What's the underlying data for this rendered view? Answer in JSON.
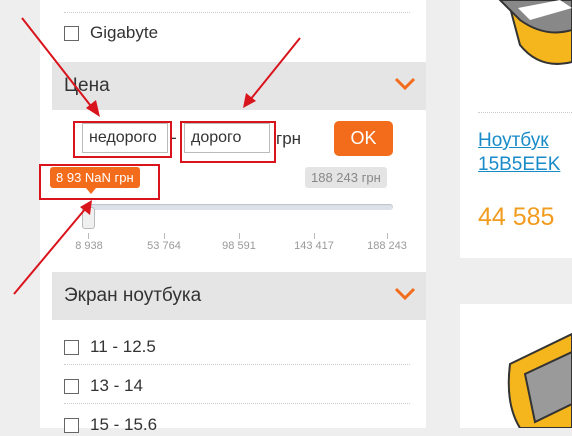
{
  "filters": {
    "brand_item": {
      "label": "Gigabyte"
    },
    "price": {
      "title": "Цена",
      "min_input_value": "недорого",
      "max_input_value": "дорого",
      "dash": "-",
      "currency": "грн",
      "ok_label": "OK",
      "badge_min": "8 93 NaN грн",
      "badge_max": "188 243 грн",
      "slider_level": 0.0,
      "ticks": [
        "8 938",
        "53 764",
        "98 591",
        "143 417",
        "188 243"
      ]
    },
    "screen": {
      "title": "Экран ноутбука",
      "items": [
        {
          "label": "11 - 12.5"
        },
        {
          "label": "13 - 14"
        },
        {
          "label": "15 - 15.6"
        }
      ]
    }
  },
  "product": {
    "title_line1": "Ноутбук",
    "title_line2": "15B5EEK",
    "price": "44 585"
  },
  "colors": {
    "accent": "#f26c1b",
    "annotation": "#d9141c",
    "link": "#1a8bc9",
    "price": "#f29c1f"
  }
}
